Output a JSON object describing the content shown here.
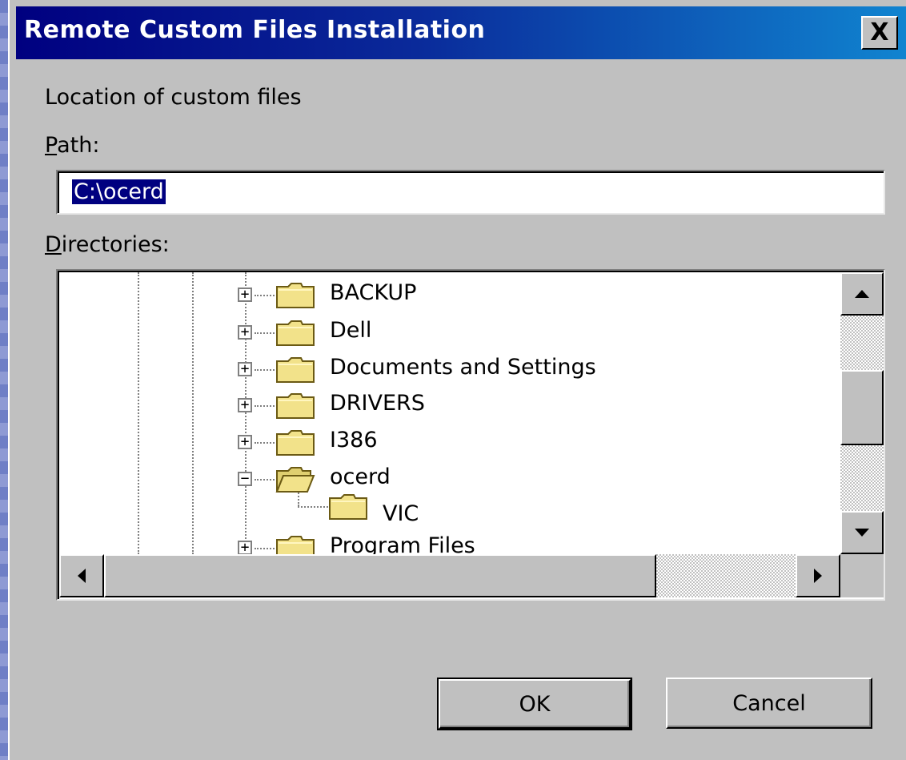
{
  "window": {
    "title": "Remote Custom Files Installation",
    "close_label": "X"
  },
  "section_label": "Location of custom files",
  "path": {
    "label_mnemonic": "P",
    "label_rest": "ath:",
    "value": "C:\\ocerd"
  },
  "directories": {
    "label_mnemonic": "D",
    "label_rest": "irectories:",
    "items": [
      {
        "label": "BACKUP",
        "expander": "+",
        "state": "collapsed"
      },
      {
        "label": "Dell",
        "expander": "+",
        "state": "collapsed"
      },
      {
        "label": "Documents and Settings",
        "expander": "+",
        "state": "collapsed"
      },
      {
        "label": "DRIVERS",
        "expander": "+",
        "state": "collapsed"
      },
      {
        "label": "I386",
        "expander": "+",
        "state": "collapsed"
      },
      {
        "label": "ocerd",
        "expander": "−",
        "state": "expanded"
      },
      {
        "label": "VIC",
        "expander": "",
        "state": "child"
      },
      {
        "label": "Program Files",
        "expander": "+",
        "state": "collapsed"
      }
    ]
  },
  "buttons": {
    "ok": "OK",
    "cancel": "Cancel"
  },
  "colors": {
    "title_start": "#000080",
    "title_end": "#1084d0",
    "face": "#c0c0c0",
    "folder": "#f2e28a",
    "selection": "#000080"
  },
  "icons": {
    "folder": "folder-icon",
    "folder_open": "folder-open-icon",
    "close": "close-icon",
    "up": "arrow-up-icon",
    "down": "arrow-down-icon",
    "left": "arrow-left-icon",
    "right": "arrow-right-icon"
  }
}
